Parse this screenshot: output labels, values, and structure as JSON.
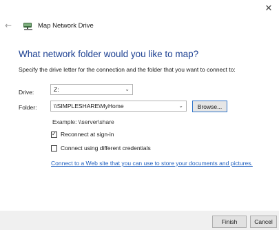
{
  "window": {
    "title": "Map Network Drive",
    "close_glyph": "✕",
    "back_glyph": "←",
    "title_icon": "network-drive-icon"
  },
  "heading": "What network folder would you like to map?",
  "instructions": "Specify the drive letter for the connection and the folder that you want to connect to:",
  "drive": {
    "label": "Drive:",
    "value": "Z:"
  },
  "folder": {
    "label": "Folder:",
    "value": "\\\\SIMPLESHARE\\MyHome"
  },
  "browse_label": "Browse...",
  "example": "Example: \\\\server\\share",
  "options": {
    "reconnect": {
      "label": "Reconnect at sign-in",
      "checked": true
    },
    "different_credentials": {
      "label": "Connect using different credentials",
      "checked": false
    }
  },
  "link_text": "Connect to a Web site that you can use to store your documents and pictures.",
  "buttons": {
    "finish": "Finish",
    "cancel": "Cancel"
  },
  "colors": {
    "heading": "#1b3f91",
    "link": "#1f5fbf",
    "focus_border": "#2e72c8",
    "footer_bg": "#f0f0f0"
  }
}
